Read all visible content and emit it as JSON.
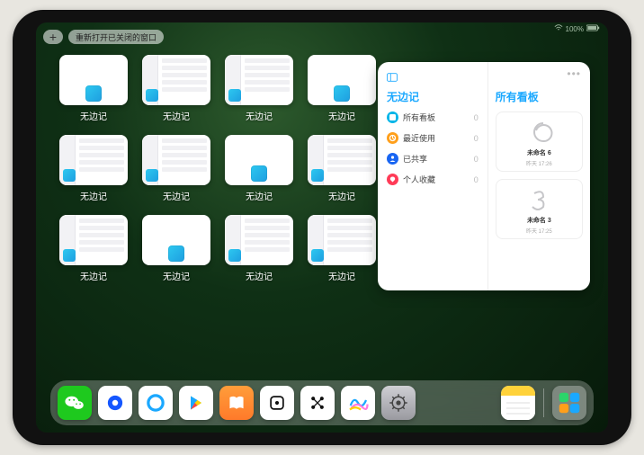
{
  "status": {
    "battery_text": "100%"
  },
  "top": {
    "plus": "+",
    "reopen_label": "重新打开已关闭的窗口"
  },
  "apps": [
    {
      "label": "无边记",
      "kind": "blank"
    },
    {
      "label": "无边记",
      "kind": "sheet"
    },
    {
      "label": "无边记",
      "kind": "sheet"
    },
    {
      "label": "无边记",
      "kind": "blank"
    },
    {
      "label": "无边记",
      "kind": "sheet"
    },
    {
      "label": "无边记",
      "kind": "sheet"
    },
    {
      "label": "无边记",
      "kind": "blank"
    },
    {
      "label": "无边记",
      "kind": "sheet"
    },
    {
      "label": "无边记",
      "kind": "sheet"
    },
    {
      "label": "无边记",
      "kind": "blank"
    },
    {
      "label": "无边记",
      "kind": "sheet"
    },
    {
      "label": "无边记",
      "kind": "sheet"
    }
  ],
  "preview": {
    "left_title": "无边记",
    "right_title": "所有看板",
    "items": [
      {
        "label": "所有看板",
        "count": "0",
        "color": "#00b5e8"
      },
      {
        "label": "最近使用",
        "count": "0",
        "color": "#ff9f1a"
      },
      {
        "label": "已共享",
        "count": "0",
        "color": "#1865f2"
      },
      {
        "label": "个人收藏",
        "count": "0",
        "color": "#ff3b57"
      }
    ],
    "boards": [
      {
        "name": "未命名 6",
        "date": "昨天 17:26",
        "sketch": "6"
      },
      {
        "name": "未命名 3",
        "date": "昨天 17:25",
        "sketch": "3"
      }
    ]
  },
  "dock": [
    {
      "name": "wechat-icon",
      "bg": "#1ec91e"
    },
    {
      "name": "browser-blue-icon",
      "bg": "#ffffff"
    },
    {
      "name": "quark-icon",
      "bg": "#ffffff"
    },
    {
      "name": "play-store-icon",
      "bg": "#ffffff"
    },
    {
      "name": "books-icon",
      "bg": "linear-gradient(180deg,#ff9d3a,#ff7a2a)"
    },
    {
      "name": "dice-icon",
      "bg": "#ffffff"
    },
    {
      "name": "share-graph-icon",
      "bg": "#ffffff"
    },
    {
      "name": "freeform-icon",
      "bg": "#ffffff"
    },
    {
      "name": "settings-icon",
      "bg": "linear-gradient(180deg,#cfcfd4,#9a9aa0)"
    },
    {
      "name": "notes-icon",
      "bg": "#ffffff"
    },
    {
      "name": "app-library-icon",
      "bg": "rgba(255,255,255,0.3)"
    }
  ]
}
